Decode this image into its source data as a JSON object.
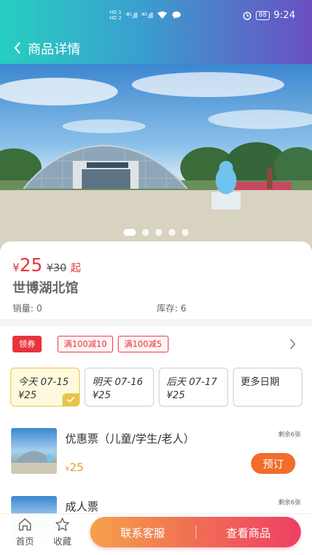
{
  "status_bar": {
    "hd1": "HD 1",
    "hd2": "HD 2",
    "net1": "⁴ᴳ.ıll",
    "net2": "⁴ᴳ.ıll",
    "battery": "88",
    "time": "9:24"
  },
  "nav": {
    "title": "商品详情",
    "back_icon": "chevron-left-icon"
  },
  "carousel": {
    "count": 5,
    "active": 0
  },
  "product": {
    "currency": "¥",
    "price": "25",
    "original_price": "¥30",
    "price_suffix": "起",
    "name": "世博湖北馆",
    "sales_label": "销量: 0",
    "stock_label": "库存: 6"
  },
  "coupons": {
    "get_label": "领券",
    "items": [
      "满100减10",
      "满100减5"
    ]
  },
  "dates": [
    {
      "day": "今天 07-15",
      "price": "¥25",
      "selected": true
    },
    {
      "day": "明天 07-16",
      "price": "¥25",
      "selected": false
    },
    {
      "day": "后天 07-17",
      "price": "¥25",
      "selected": false
    },
    {
      "day": "更多日期",
      "price": "",
      "selected": false
    }
  ],
  "tickets": [
    {
      "name": "优惠票（儿童/学生/老人）",
      "remaining": "剩余6张",
      "currency": "¥",
      "price": "25",
      "action": "预订"
    },
    {
      "name": "成人票",
      "remaining": "剩余6张",
      "currency": "",
      "price": "",
      "action": ""
    }
  ],
  "bottom_bar": {
    "home_label": "首页",
    "fav_label": "收藏",
    "contact_label": "联系客服",
    "view_label": "查看商品"
  },
  "colors": {
    "accent_red": "#e8333a",
    "book_orange": "#f26c2b",
    "select_yellow": "#e8c44d"
  }
}
